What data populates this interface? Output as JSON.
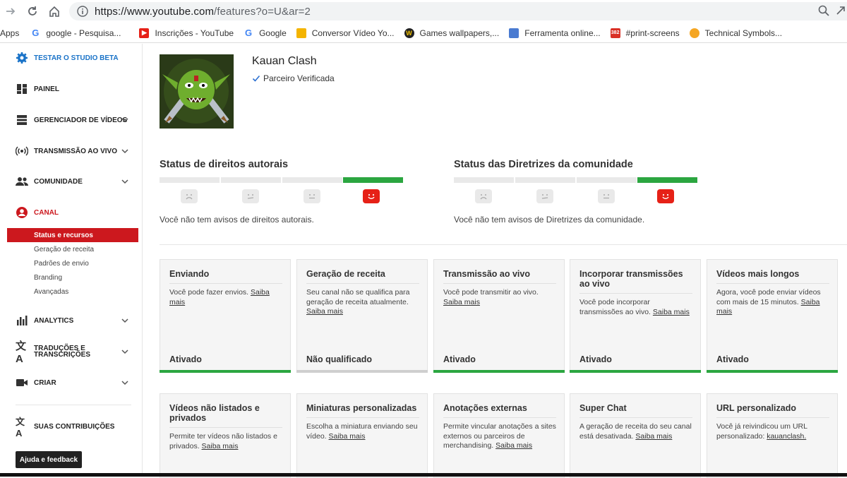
{
  "browser": {
    "url_host": "https://www.youtube.com",
    "url_path": "/features?o=U&ar=2",
    "bookmarks": [
      {
        "label": "Apps",
        "icon": "apps-icon"
      },
      {
        "label": "google - Pesquisa...",
        "icon": "google-icon"
      },
      {
        "label": "Inscrições - YouTube",
        "icon": "youtube-icon"
      },
      {
        "label": "Google",
        "icon": "google-icon"
      },
      {
        "label": "Conversor Vídeo Yo...",
        "icon": "converter-icon"
      },
      {
        "label": "Games wallpapers,...",
        "icon": "wallpaper-icon"
      },
      {
        "label": "Ferramenta online...",
        "icon": "tool-icon"
      },
      {
        "label": "#print-screens",
        "icon": "calendar-icon"
      },
      {
        "label": "Technical Symbols...",
        "icon": "emoji-icon"
      }
    ]
  },
  "sidebar": {
    "items": [
      {
        "label": "TESTAR O STUDIO BETA",
        "icon": "gear-icon",
        "color": "#1a73c8"
      },
      {
        "label": "PAINEL",
        "icon": "dashboard-icon"
      },
      {
        "label": "GERENCIADOR DE VÍDEOS",
        "icon": "video-manager-icon"
      },
      {
        "label": "TRANSMISSÃO AO VIVO",
        "icon": "live-broadcast-icon"
      },
      {
        "label": "COMUNIDADE",
        "icon": "community-icon"
      },
      {
        "label": "CANAL",
        "icon": "channel-icon",
        "color": "#cc181e"
      },
      {
        "label": "ANALYTICS",
        "icon": "analytics-icon"
      },
      {
        "label": "TRADUÇÕES E TRANSCRIÇÕES",
        "icon": "translate-icon"
      },
      {
        "label": "CRIAR",
        "icon": "create-video-icon"
      },
      {
        "label": "SUAS CONTRIBUIÇÕES",
        "icon": "translate-icon"
      }
    ],
    "subitems": [
      "Status e recursos",
      "Geração de receita",
      "Padrões de envio",
      "Branding",
      "Avançadas"
    ],
    "feedback": "Ajuda e feedback"
  },
  "channel": {
    "name": "Kauan Clash",
    "verified": "Parceiro Verificada"
  },
  "copyright": {
    "title": "Status de direitos autorais",
    "text": "Você não tem avisos de direitos autorais.",
    "level": 4
  },
  "community": {
    "title": "Status das Diretrizes da comunidade",
    "text": "Você não tem avisos de Diretrizes da comunidade.",
    "level": 4
  },
  "features": [
    {
      "title": "Enviando",
      "desc": "Você pode fazer envios.",
      "link": "Saiba mais",
      "status": "Ativado",
      "active": true
    },
    {
      "title": "Geração de receita",
      "desc": "Seu canal não se qualifica para geração de receita atualmente.",
      "link": "Saiba mais",
      "status": "Não qualificado",
      "active": false
    },
    {
      "title": "Transmissão ao vivo",
      "desc": "Você pode transmitir ao vivo.",
      "link": "Saiba mais",
      "status": "Ativado",
      "active": true
    },
    {
      "title": "Incorporar transmissões ao vivo",
      "desc": "Você pode incorporar transmissões ao vivo.",
      "link": "Saiba mais",
      "status": "Ativado",
      "active": true
    },
    {
      "title": "Vídeos mais longos",
      "desc": "Agora, você pode enviar vídeos com mais de 15 minutos.",
      "link": "Saiba mais",
      "status": "Ativado",
      "active": true
    },
    {
      "title": "Vídeos não listados e privados",
      "desc": "Permite ter vídeos não listados e privados.",
      "link": "Saiba mais"
    },
    {
      "title": "Miniaturas personalizadas",
      "desc": "Escolha a miniatura enviando seu vídeo.",
      "link": "Saiba mais"
    },
    {
      "title": "Anotações externas",
      "desc": "Permite vincular anotações a sites externos ou parceiros de merchandising.",
      "link": "Saiba mais"
    },
    {
      "title": "Super Chat",
      "desc": "A geração de receita do seu canal está desativada.",
      "link": "Saiba mais"
    },
    {
      "title": "URL personalizado",
      "desc": "Você já reivindicou um URL personalizado:",
      "link": "kauanclash."
    }
  ],
  "colors": {
    "accent_red": "#cc181e",
    "active_green": "#2ba640",
    "beta_blue": "#1a73c8"
  }
}
